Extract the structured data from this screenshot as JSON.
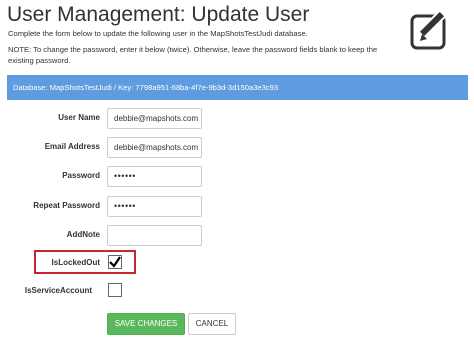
{
  "page": {
    "title": "User Management: Update User",
    "intro": "Complete the form below to update the following user in the MapShotsTestJudi database.",
    "note": "NOTE: To change the password, enter it below (twice). Otherwise, leave the password fields blank to keep the existing password.",
    "icon": "edit-icon"
  },
  "banner": {
    "text": "Database: MapShotsTestJudi / Key: 7798a951-68ba-4f7e-9b3d-3d150a3e3c93",
    "color": "#5f9cdf"
  },
  "form": {
    "username_label": "User Name",
    "username_value": "debbie@mapshots.com",
    "email_label": "Email Address",
    "email_value": "debbie@mapshots.com",
    "password_label": "Password",
    "password_value": "••••••",
    "repeat_label": "Repeat Password",
    "repeat_value": "••••••",
    "addnote_label": "AddNote",
    "addnote_value": "",
    "locked_label": "IsLockedOut",
    "locked_checked": true,
    "service_label": "IsServiceAccount",
    "service_checked": false,
    "highlight_color": "#c6262e"
  },
  "buttons": {
    "save_label": "SAVE CHANGES",
    "save_color": "#5cb85c",
    "cancel_label": "CANCEL"
  }
}
